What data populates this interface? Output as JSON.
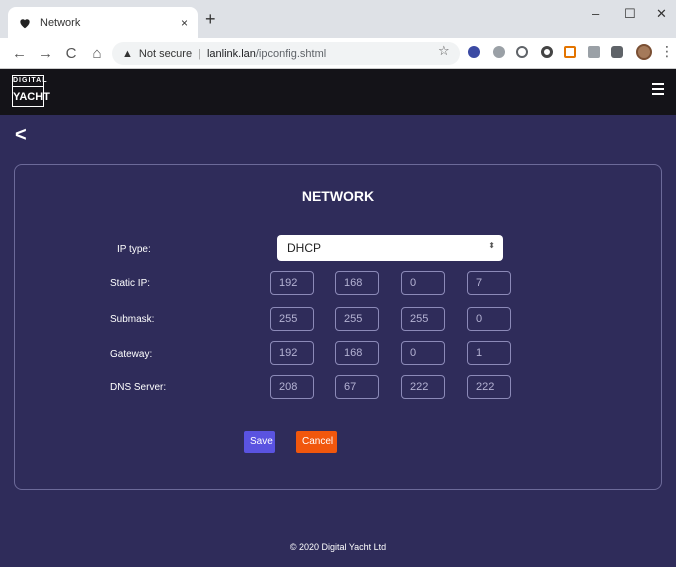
{
  "browser": {
    "tab_title": "Network",
    "tab_close": "×",
    "new_tab": "+",
    "minimize": "–",
    "maximize": "☐",
    "close": "✕",
    "back": "←",
    "forward": "→",
    "reload": "C",
    "home": "⌂",
    "security_label": "Not secure",
    "url_host": "lanlink.lan",
    "url_path": "/ipconfig.shtml",
    "star": "☆",
    "menu": "⋮"
  },
  "header": {
    "logo_line1": "DIGITAL",
    "logo_line2": "YACHT"
  },
  "back_arrow": "<",
  "form": {
    "title": "NETWORK",
    "ip_type_label": "IP type:",
    "ip_type_value": "DHCP",
    "static_ip_label": "Static IP:",
    "static_ip": [
      "192",
      "168",
      "0",
      "7"
    ],
    "submask_label": "Submask:",
    "submask": [
      "255",
      "255",
      "255",
      "0"
    ],
    "gateway_label": "Gateway:",
    "gateway": [
      "192",
      "168",
      "0",
      "1"
    ],
    "dns_label": "DNS Server:",
    "dns": [
      "208",
      "67",
      "222",
      "222"
    ],
    "save_label": "Save",
    "cancel_label": "Cancel"
  },
  "footer": "© 2020 Digital Yacht Ltd",
  "colors": {
    "background": "#2f2c5a",
    "header": "#141318",
    "save": "#5a53e0",
    "cancel": "#f1570d"
  }
}
